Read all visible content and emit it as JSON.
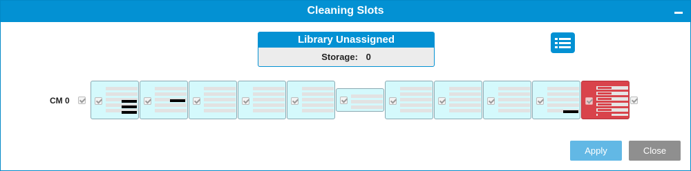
{
  "dialog": {
    "title": "Cleaning Slots",
    "minimize_icon": "minimize-icon"
  },
  "library": {
    "header": "Library Unassigned",
    "storage_label": "Storage:",
    "storage_value": "0"
  },
  "list_view_icon": "list-view-icon",
  "row": {
    "label": "CM 0",
    "magazine_count": 11
  },
  "buttons": {
    "apply": "Apply",
    "close": "Close"
  },
  "colors": {
    "titlebar": "#0391d3",
    "magazine": "#d4f9fc",
    "cleaning_magazine": "#d9434b",
    "apply": "#62b8e5",
    "close": "#8f8f8f"
  }
}
